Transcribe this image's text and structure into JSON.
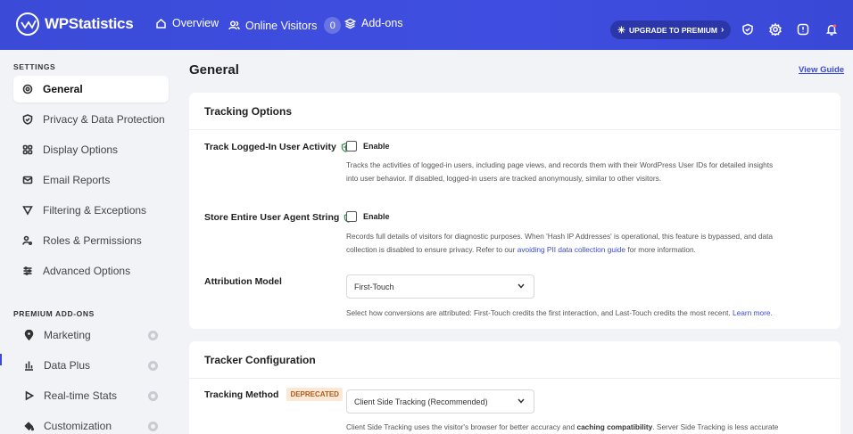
{
  "topbar": {
    "brand": "WPStatistics",
    "nav": [
      {
        "label": "Overview",
        "icon": "home-icon"
      },
      {
        "label": "Online Visitors",
        "icon": "users-icon",
        "count": "0"
      },
      {
        "label": "Add-ons",
        "icon": "layers-icon"
      }
    ],
    "upgrade_label": "UPGRADE TO PREMIUM",
    "icons": [
      "shield-check-icon",
      "gear-icon",
      "info-icon",
      "bell-icon"
    ],
    "accent": "#3b4bd8"
  },
  "sidebar": {
    "settings_heading": "SETTINGS",
    "items": [
      {
        "label": "General",
        "icon": "gear-icon",
        "active": true
      },
      {
        "label": "Privacy & Data Protection",
        "icon": "shield-icon"
      },
      {
        "label": "Display Options",
        "icon": "grid-icon"
      },
      {
        "label": "Email Reports",
        "icon": "envelope-icon"
      },
      {
        "label": "Filtering & Exceptions",
        "icon": "filter-icon"
      },
      {
        "label": "Roles & Permissions",
        "icon": "user-key-icon"
      },
      {
        "label": "Advanced Options",
        "icon": "sliders-icon"
      }
    ],
    "premium_heading": "PREMIUM ADD-ONS",
    "addons": [
      {
        "label": "Marketing",
        "icon": "marker-icon"
      },
      {
        "label": "Data Plus",
        "icon": "bar-chart-icon"
      },
      {
        "label": "Real-time Stats",
        "icon": "play-icon"
      },
      {
        "label": "Customization",
        "icon": "paint-bucket-icon"
      }
    ]
  },
  "main": {
    "title": "General",
    "view_guide": "View Guide",
    "tracking_options": {
      "heading": "Tracking Options",
      "logged_in": {
        "label": "Track Logged-In User Activity",
        "checkbox_label": "Enable",
        "checked": false,
        "desc_line1": "Tracks the activities of logged-in users, including page views, and records them with their WordPress User IDs for detailed insights",
        "desc_line2": "into user behavior. If disabled, logged-in users are tracked anonymously, similar to other visitors."
      },
      "user_agent": {
        "label": "Store Entire User Agent String",
        "checkbox_label": "Enable",
        "checked": false,
        "desc_line1": "Records full details of visitors for diagnostic purposes. When 'Hash IP Addresses' is operational, this feature is bypassed, and data",
        "desc_line2_pre": "collection is disabled to ensure privacy. Refer to our ",
        "desc_link": "avoiding PII data collection guide",
        "desc_line2_post": " for more information."
      },
      "attribution": {
        "label": "Attribution Model",
        "value": "First-Touch",
        "desc": "Select how conversions are attributed: First-Touch credits the first interaction, and Last-Touch credits the most recent. ",
        "desc_link": "Learn more."
      }
    },
    "tracker_configuration": {
      "heading": "Tracker Configuration",
      "method": {
        "label": "Tracking Method",
        "badge": "DEPRECATED",
        "value": "Client Side Tracking (Recommended)",
        "desc_pre": "Client Side Tracking uses the visitor's browser for better accuracy and ",
        "desc_bold": "caching compatibility",
        "desc_post": ". Server Side Tracking is less accurate"
      }
    }
  }
}
